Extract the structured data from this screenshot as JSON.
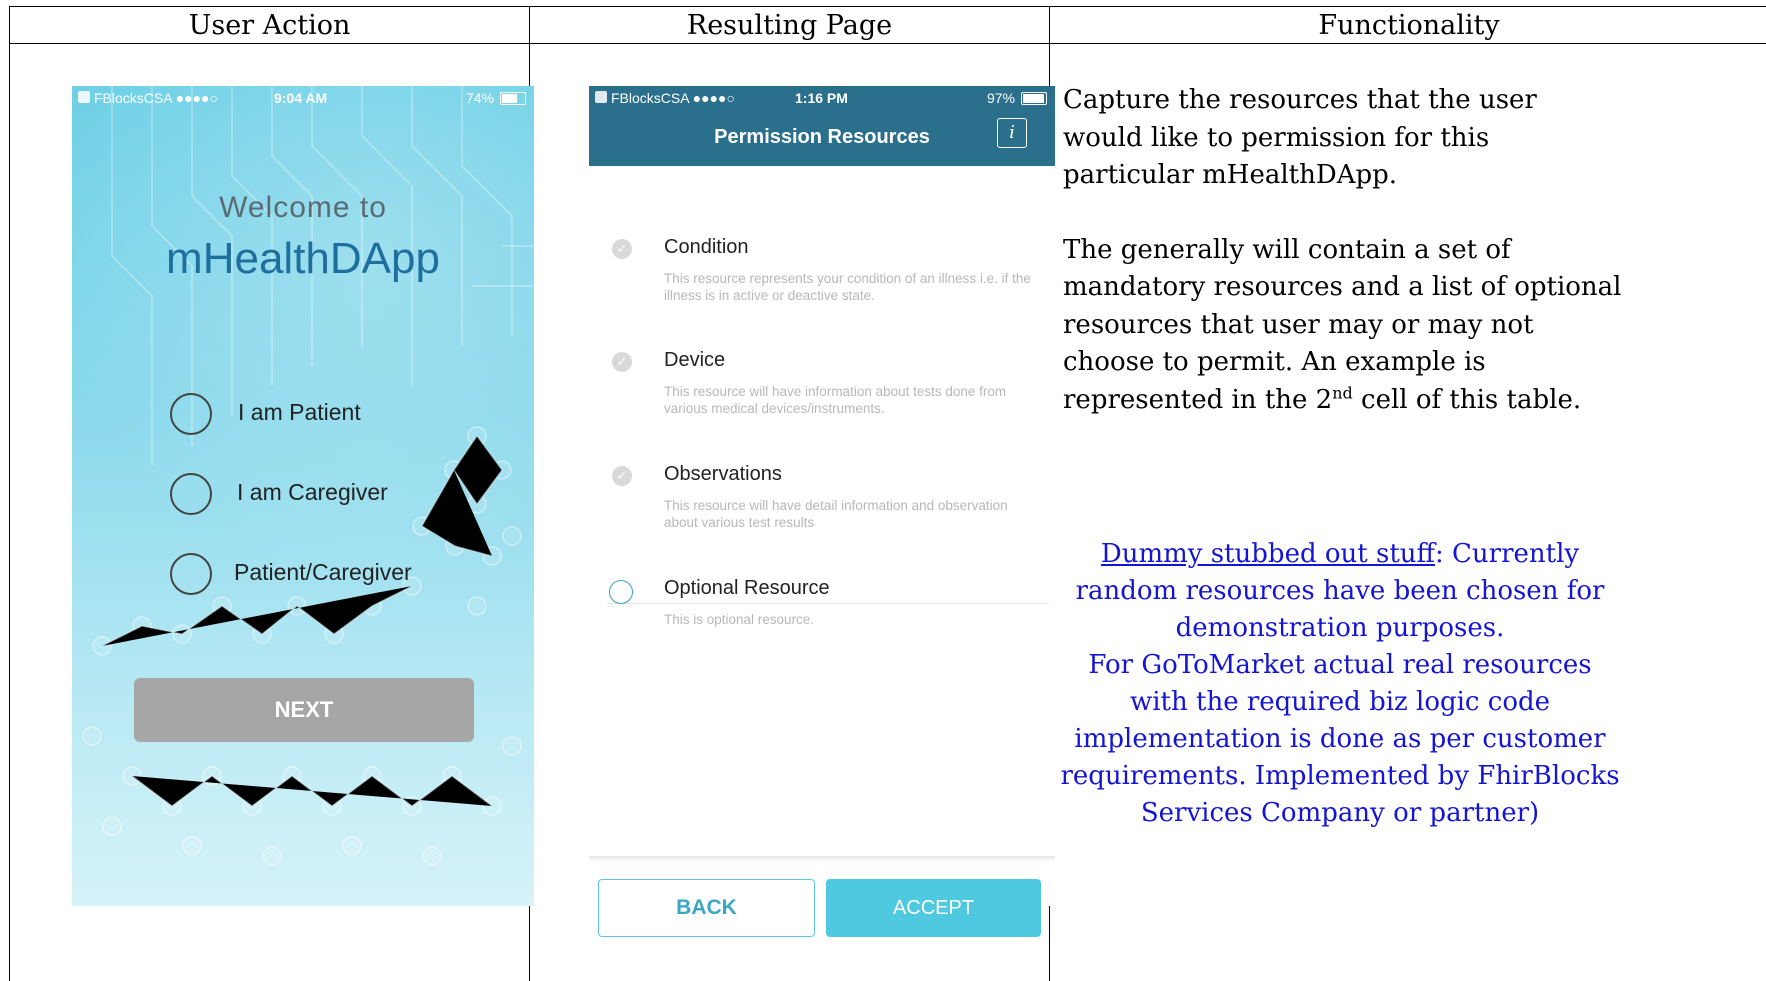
{
  "columns": [
    "User Action",
    "Resulting Page",
    "Functionality"
  ],
  "phone1": {
    "status": {
      "carrier": "FBlocksCSA ●●●●○",
      "time": "9:04 AM",
      "battery": "74%"
    },
    "welcome": "Welcome  to",
    "app_name": "mHealthDApp",
    "roles": [
      "I am Patient",
      "I am Caregiver",
      "Patient/Caregiver"
    ],
    "next_label": "NEXT"
  },
  "phone2": {
    "status": {
      "carrier": "FBlocksCSA ●●●●○",
      "time": "1:16 PM",
      "battery": "97%"
    },
    "title": "Permission Resources",
    "info_icon": "i",
    "resources": [
      {
        "name": "Condition",
        "desc": "This resource represents your condition of an illness i.e. if the illness is in active or deactive state."
      },
      {
        "name": "Device",
        "desc": "This resource will have information about tests done from various medical devices/instruments."
      },
      {
        "name": "Observations",
        "desc": "This resource will have detail information and observation about various test results"
      },
      {
        "name": "Optional Resource",
        "desc": "This is optional resource."
      }
    ],
    "back_label": "BACK",
    "accept_label": "ACCEPT"
  },
  "functionality": {
    "para1": "Capture the resources that the user would like to permission for this particular mHealthDApp.",
    "para2_main": "The generally will contain a set of mandatory resources and a list of optional resources that user may or may not choose to permit.  An example is represented in the  2",
    "para2_sup": "nd",
    "para2_tail": " cell of this table.",
    "note_link": "Dummy stubbed out stuff",
    "note_line1": ":  Currently random resources have been chosen for demonstration purposes.",
    "note_line2": "For GoToMarket actual real resources with the required biz logic code implementation is done as per customer requirements.  Implemented by FhirBlocks Services Company or partner)"
  },
  "colors": {
    "header_bar": "#2a6f8c",
    "accept": "#4ec9e0",
    "note_text": "#1414d4"
  }
}
